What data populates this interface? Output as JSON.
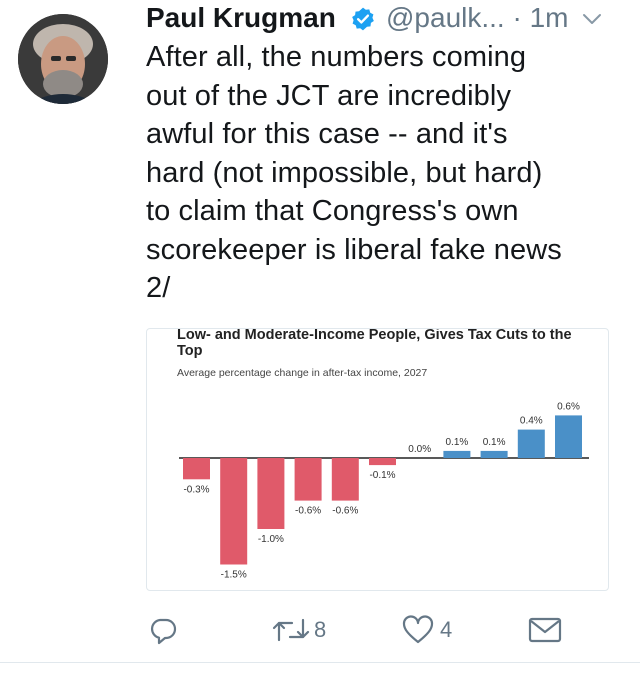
{
  "tweet": {
    "display_name": "Paul Krugman",
    "handle_time": "@paulk... · 1m",
    "text": "After all, the numbers coming\nout of the JCT are incredibly\nawful for this case -- and it's\nhard (not impossible, but hard)\nto claim that Congress's own\nscorekeeper is liberal fake news\n2/"
  },
  "actions": {
    "retweet_count": "8",
    "like_count": "4"
  },
  "colors": {
    "negative": "#e05a6a",
    "positive": "#4a90c8",
    "icon": "#657786",
    "verified": "#1da1f2"
  },
  "icons": [
    "verified-badge-icon",
    "chevron-down-icon",
    "reply-icon",
    "retweet-icon",
    "like-icon",
    "direct-message-icon"
  ],
  "chart_data": {
    "type": "bar",
    "title": "Low- and Moderate-Income People, Gives Tax Cuts to the Top",
    "subtitle": "Average percentage change in after-tax income, 2027",
    "values": [
      -0.3,
      -1.5,
      -1.0,
      -0.6,
      -0.6,
      -0.1,
      0.0,
      0.1,
      0.1,
      0.4,
      0.6
    ],
    "labels": [
      "-0.3%",
      "-1.5%",
      "-1.0%",
      "-0.6%",
      "-0.6%",
      "-0.1%",
      "0.0%",
      "0.1%",
      "0.1%",
      "0.4%",
      "0.6%"
    ],
    "ylim": [
      -1.5,
      0.6
    ],
    "grid": false,
    "legend": "none"
  }
}
